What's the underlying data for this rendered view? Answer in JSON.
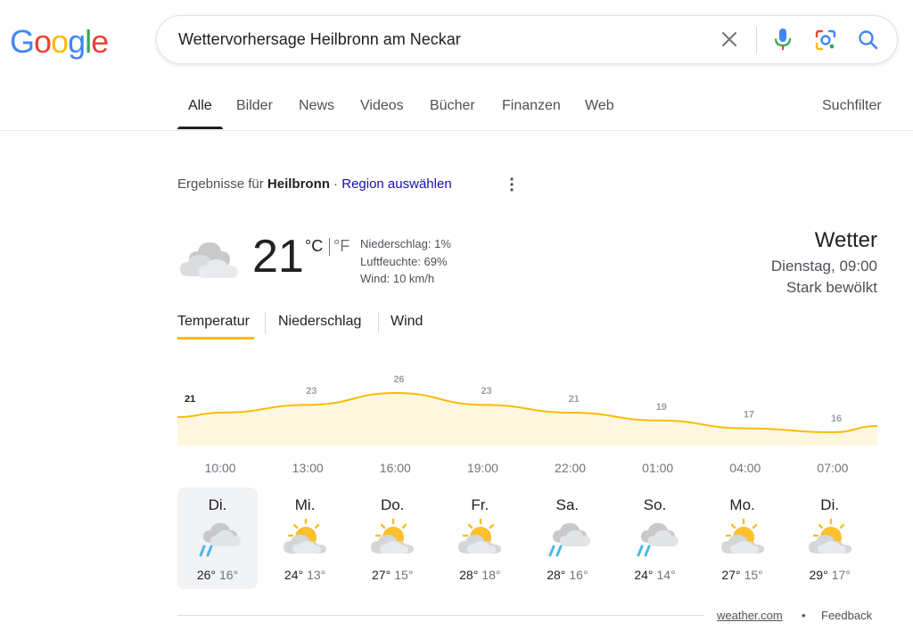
{
  "logo": {
    "letters": [
      "G",
      "o",
      "o",
      "g",
      "l",
      "e"
    ],
    "colors": [
      "#4285F4",
      "#EA4335",
      "#FBBC05",
      "#4285F4",
      "#34A853",
      "#EA4335"
    ]
  },
  "search": {
    "query": "Wettervorhersage Heilbronn am Neckar"
  },
  "tabs": [
    "Alle",
    "Bilder",
    "News",
    "Videos",
    "Bücher",
    "Finanzen",
    "Web"
  ],
  "suchfilter": "Suchfilter",
  "results_for": {
    "prefix": "Ergebnisse für ",
    "city": "Heilbronn",
    "separator": " · ",
    "region_link": "Region auswählen"
  },
  "current": {
    "temp": "21",
    "unit_c": "°C",
    "unit_f": "°F",
    "precip": "Niederschlag: 1%",
    "humidity": "Luftfeuchte: 69%",
    "wind": "Wind: 10 km/h",
    "title": "Wetter",
    "time": "Dienstag, 09:00",
    "condition": "Stark bewölkt"
  },
  "metric_tabs": [
    "Temperatur",
    "Niederschlag",
    "Wind"
  ],
  "chart_data": {
    "type": "area",
    "color": "#fbbc04",
    "fill": "#fef7e0",
    "x": [
      "10:00",
      "13:00",
      "16:00",
      "19:00",
      "22:00",
      "01:00",
      "04:00",
      "07:00"
    ],
    "values": [
      21,
      23,
      26,
      23,
      21,
      19,
      17,
      16
    ],
    "ylim": [
      0,
      30
    ]
  },
  "days": [
    {
      "name": "Di.",
      "hi": "26°",
      "lo": "16°",
      "icon": "rain-cloud-icon"
    },
    {
      "name": "Mi.",
      "hi": "24°",
      "lo": "13°",
      "icon": "partly-sunny-icon"
    },
    {
      "name": "Do.",
      "hi": "27°",
      "lo": "15°",
      "icon": "partly-sunny-icon"
    },
    {
      "name": "Fr.",
      "hi": "28°",
      "lo": "18°",
      "icon": "partly-sunny-icon"
    },
    {
      "name": "Sa.",
      "hi": "28°",
      "lo": "16°",
      "icon": "rain-cloud-icon"
    },
    {
      "name": "So.",
      "hi": "24°",
      "lo": "14°",
      "icon": "rain-cloud-icon"
    },
    {
      "name": "Mo.",
      "hi": "27°",
      "lo": "15°",
      "icon": "partly-sunny-icon"
    },
    {
      "name": "Di.",
      "hi": "29°",
      "lo": "17°",
      "icon": "partly-sunny-icon"
    }
  ],
  "footer": {
    "source": "weather.com",
    "dot": "•",
    "feedback": "Feedback"
  }
}
